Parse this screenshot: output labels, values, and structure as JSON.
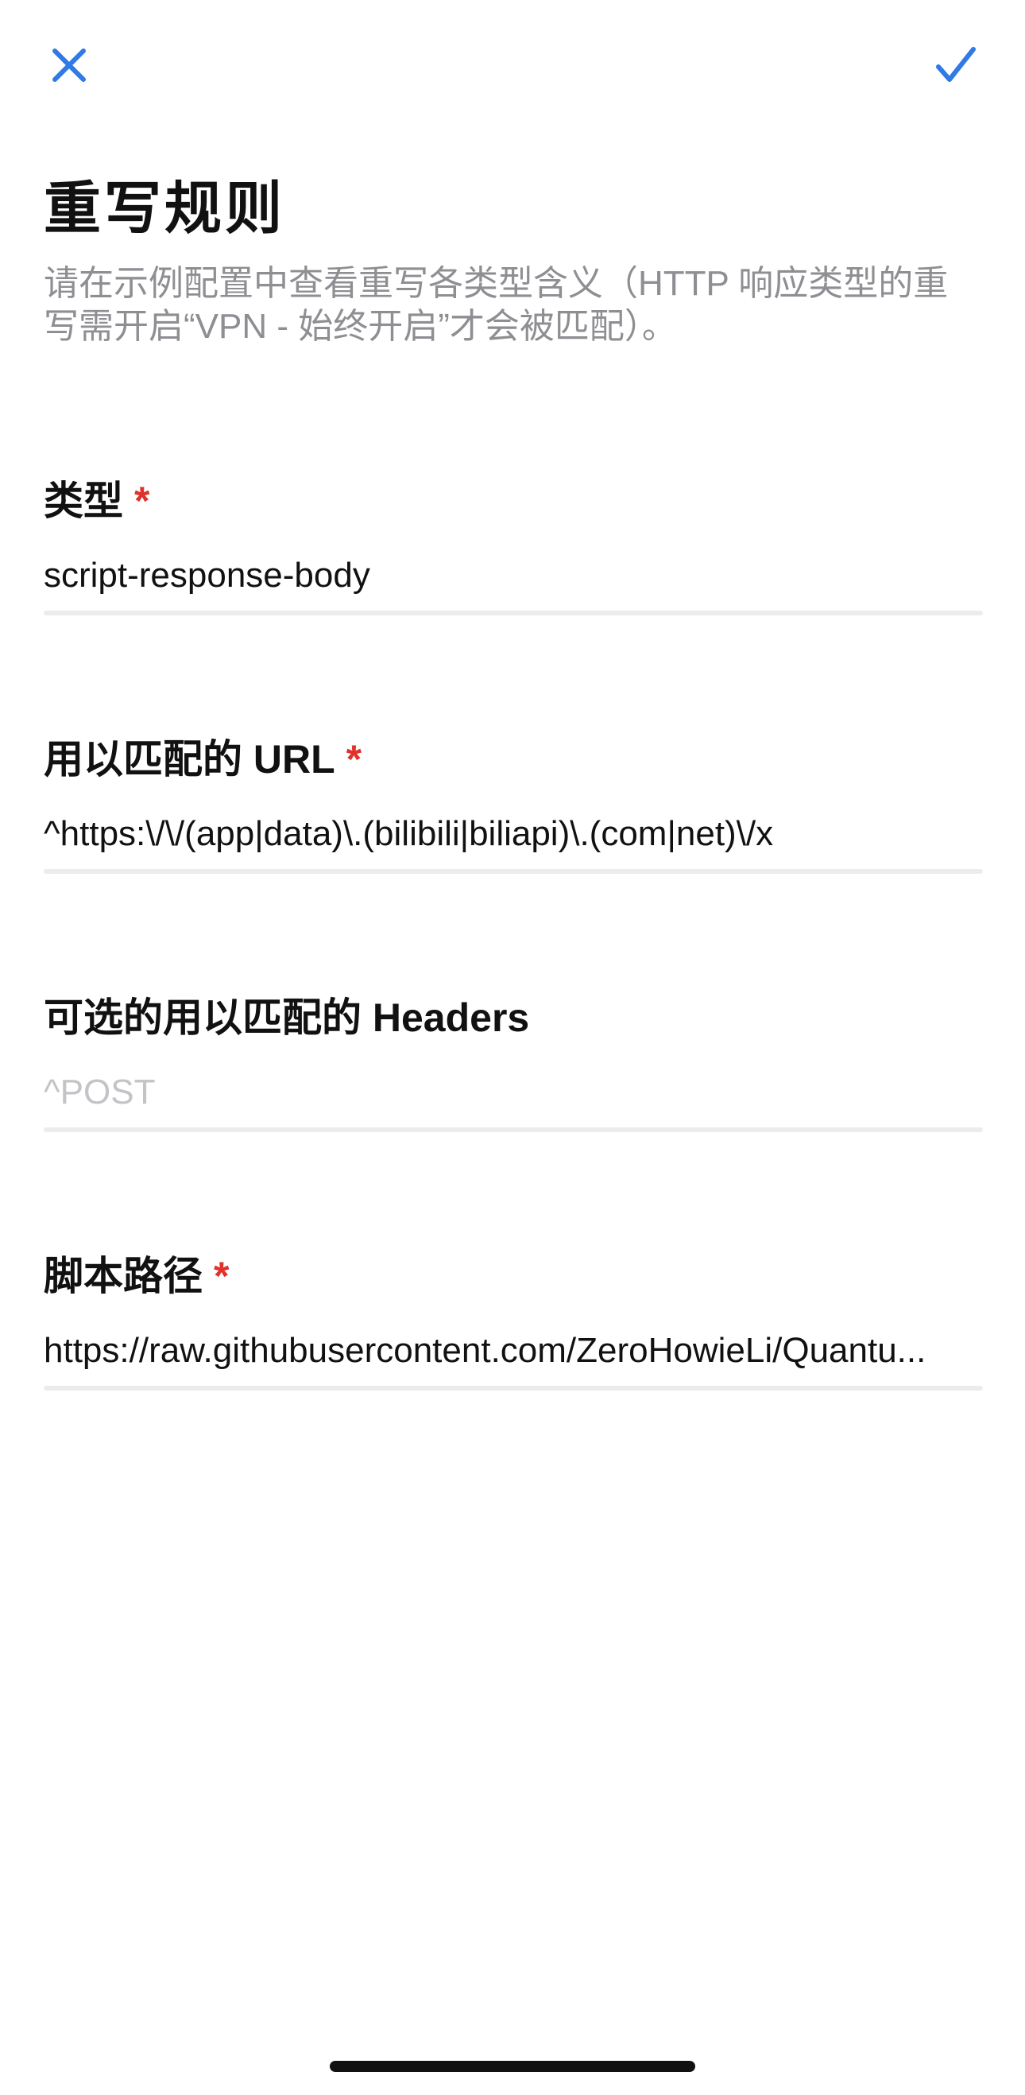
{
  "nav": {
    "close_icon": "close-icon",
    "confirm_icon": "checkmark-icon",
    "accent_color": "#2f7ae5"
  },
  "header": {
    "title": "重写规则",
    "subtitle": "请在示例配置中查看重写各类型含义（HTTP 响应类型的重写需开启“VPN - 始终开启”才会被匹配）。"
  },
  "fields": [
    {
      "label": "类型",
      "required": "*",
      "value": "script-response-body"
    },
    {
      "label": "用以匹配的 URL",
      "required": "*",
      "value": "^https:\\/\\/(app|data)\\.(bilibili|biliapi)\\.(com|net)\\/x"
    },
    {
      "label": "可选的用以匹配的 Headers",
      "placeholder": "^POST"
    },
    {
      "label": "脚本路径",
      "required": "*",
      "value": "https://raw.githubusercontent.com/ZeroHowieLi/Quantu..."
    }
  ],
  "colors": {
    "required_star": "#e0312b",
    "subtitle_text": "#8e8e93",
    "placeholder_text": "#c4c4c8",
    "divider": "#ececee"
  }
}
